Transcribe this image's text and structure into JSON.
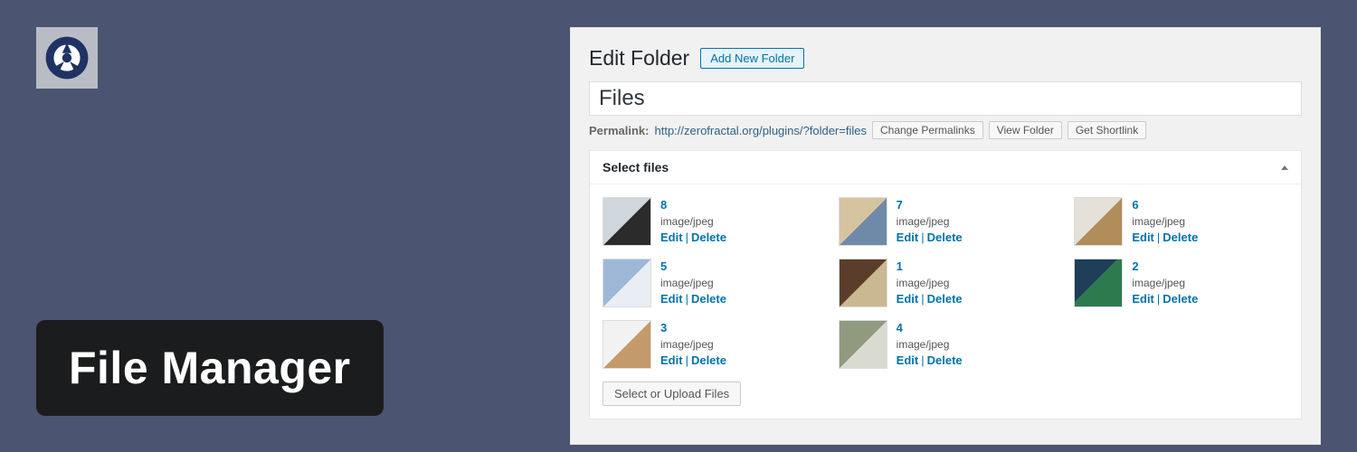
{
  "page_title": "File Manager",
  "wp": {
    "heading": "Edit Folder",
    "add_new": "Add New Folder",
    "folder_title": "Files",
    "permalink_label": "Permalink:",
    "permalink_url": "http://zerofractal.org/plugins/?folder=files",
    "buttons": {
      "change_permalinks": "Change Permalinks",
      "view_folder": "View Folder",
      "get_shortlink": "Get Shortlink",
      "select_upload": "Select or Upload Files"
    },
    "metabox_title": "Select files",
    "file_mime": "image/jpeg",
    "actions": {
      "edit": "Edit",
      "delete": "Delete"
    },
    "files": [
      {
        "name": "8",
        "thumb": "t-8"
      },
      {
        "name": "7",
        "thumb": "t-7"
      },
      {
        "name": "6",
        "thumb": "t-6"
      },
      {
        "name": "5",
        "thumb": "t-5"
      },
      {
        "name": "1",
        "thumb": "t-1"
      },
      {
        "name": "2",
        "thumb": "t-2"
      },
      {
        "name": "3",
        "thumb": "t-3"
      },
      {
        "name": "4",
        "thumb": "t-4"
      }
    ]
  }
}
